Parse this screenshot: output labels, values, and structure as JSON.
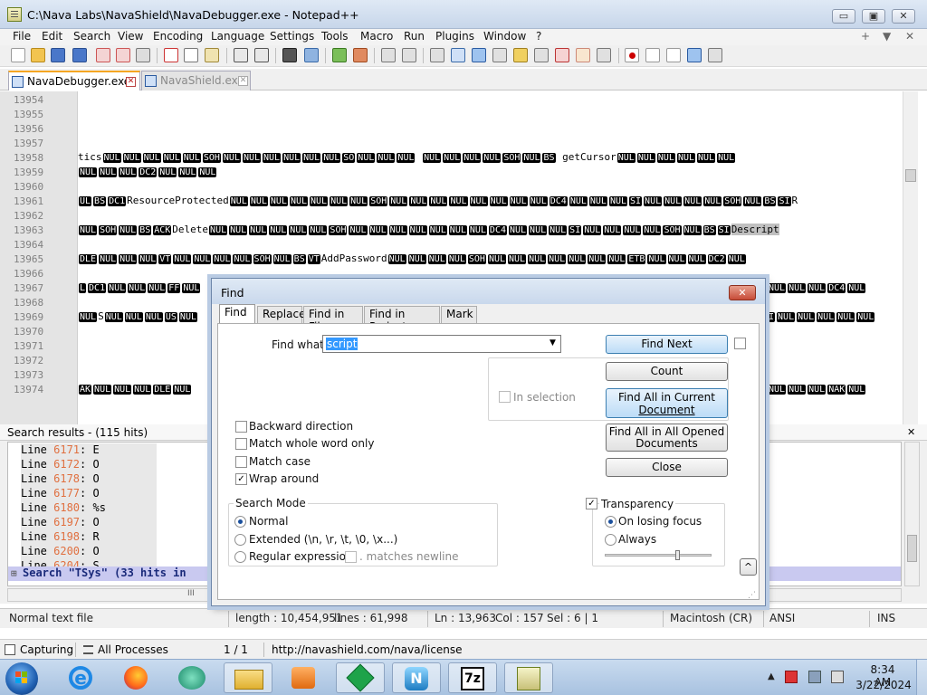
{
  "window": {
    "title": "C:\\Nava Labs\\NavaShield\\NavaDebugger.exe - Notepad++",
    "minimize": "▭",
    "restore": "▣",
    "close": "✕"
  },
  "menu": {
    "items": [
      "File",
      "Edit",
      "Search",
      "View",
      "Encoding",
      "Language",
      "Settings",
      "Tools",
      "Macro",
      "Run",
      "Plugins",
      "Window",
      "?"
    ],
    "right_controls": [
      "+",
      "▼",
      "✕"
    ]
  },
  "tabs": [
    {
      "label": "NavaDebugger.exe",
      "active": true
    },
    {
      "label": "NavaShield.exe",
      "active": false
    }
  ],
  "editor": {
    "lines": [
      {
        "n": "13954",
        "text": ""
      },
      {
        "n": "13955",
        "text": ""
      },
      {
        "n": "13956",
        "text": ""
      },
      {
        "n": "13957",
        "text": ""
      },
      {
        "n": "13958",
        "text": "tics[NUL][NUL][NUL][NUL][NUL][SOH][NUL][NUL][NUL][NUL][NUL][NUL][SO][NUL][NUL][NUL]    [NUL][NUL][NUL][NUL][SOH][NUL][BS]  getCursor[NUL][NUL][NUL][NUL][NUL][NUL]"
      },
      {
        "n": "13959",
        "text": "[NUL][NUL][NUL][DC2][NUL][NUL][NUL]"
      },
      {
        "n": "13960",
        "text": ""
      },
      {
        "n": "13961",
        "text": "[UL][BS][DC1]ResourceProtected[NUL][NUL][NUL][NUL][NUL][NUL][NUL][SOH][NUL][NUL][NUL][NUL][NUL][NUL][NUL][NUL][DC4][NUL][NUL][NUL][SI][NUL][NUL][NUL][NUL][SOH][NUL][BS][SI]R"
      },
      {
        "n": "13962",
        "text": ""
      },
      {
        "n": "13963",
        "text": "[NUL][SOH][NUL][BS][ACK]Delete[NUL][NUL][NUL][NUL][NUL][NUL][SOH][NUL][NUL][NUL][NUL][NUL][NUL][NUL][DC4][NUL][NUL][NUL][SI][NUL][NUL][NUL][NUL][SOH][NUL][BS][SI]{Descript}"
      },
      {
        "n": "13964",
        "text": ""
      },
      {
        "n": "13965",
        "text": "[DLE][NUL][NUL][NUL][VT][NUL][NUL][NUL][NUL][SOH][NUL][BS][VT]AddPassword[NUL][NUL][NUL][NUL][SOH][NUL][NUL][NUL][NUL][NUL][NUL][NUL][ETB][NUL][NUL][NUL][DC2][NUL]"
      },
      {
        "n": "13966",
        "text": ""
      },
      {
        "n": "13967",
        "text": "[L][DC1][NUL][NUL][NUL][FF][NUL]"
      },
      {
        "n": "13968",
        "text": ""
      },
      {
        "n": "13969",
        "text": "[NUL]S[NUL][NUL][NUL][US][NUL]"
      },
      {
        "n": "13970",
        "text": ""
      },
      {
        "n": "13971",
        "text": ""
      },
      {
        "n": "13972",
        "text": ""
      },
      {
        "n": "13973",
        "text": ""
      },
      {
        "n": "13974",
        "text": "[AK][NUL][NUL][NUL][DLE][NUL]"
      }
    ],
    "right_fragments": [
      {
        "line": "13967",
        "text": "[NUL][NUL][NUL][DC4][NUL]"
      },
      {
        "line": "13969",
        "text": "[I][NUL][NUL][NUL][NUL][NUL]"
      },
      {
        "line": "13974",
        "text": "[NUL][NUL][NUL][NAK][NUL]"
      }
    ]
  },
  "results": {
    "title": "Search results - (115 hits)",
    "close": "✕",
    "lines": [
      {
        "label": "Line",
        "num": "6171",
        "text": "E"
      },
      {
        "label": "Line",
        "num": "6172",
        "text": "O"
      },
      {
        "label": "Line",
        "num": "6178",
        "text": "O"
      },
      {
        "label": "Line",
        "num": "6177",
        "text": "O"
      },
      {
        "label": "Line",
        "num": "6180",
        "text": "%s"
      },
      {
        "label": "Line",
        "num": "6197",
        "text": "O"
      },
      {
        "label": "Line",
        "num": "6198",
        "text": "R"
      },
      {
        "label": "Line",
        "num": "6200",
        "text": "O"
      },
      {
        "label": "Line",
        "num": "6204",
        "text": "S"
      }
    ],
    "summary": "Search \"TSys\" (33 hits in",
    "scroll_marker": "III"
  },
  "find_dialog": {
    "title": "Find",
    "close": "✕",
    "tabs": [
      "Find",
      "Replace",
      "Find in Files",
      "Find in Projects",
      "Mark"
    ],
    "find_what_label": "Find what:",
    "find_what_value": "script",
    "in_selection": "In selection",
    "buttons": {
      "find_next": "Find Next",
      "count": "Count",
      "find_all_current_1": "Find All in Current",
      "find_all_current_2": "Document",
      "find_all_opened_1": "Find All in All Opened",
      "find_all_opened_2": "Documents",
      "close": "Close",
      "collapse": "^"
    },
    "options": [
      {
        "label": "Backward direction",
        "checked": false
      },
      {
        "label": "Match whole word only",
        "checked": false
      },
      {
        "label": "Match case",
        "checked": false
      },
      {
        "label": "Wrap around",
        "checked": true
      }
    ],
    "search_mode": {
      "title": "Search Mode",
      "normal": "Normal",
      "extended": "Extended (\\n, \\r, \\t, \\0, \\x...)",
      "regex": "Regular expression",
      "matches_newline": ". matches newline",
      "selected": "Normal"
    },
    "transparency": {
      "label": "Transparency",
      "checked": true,
      "on_losing_focus": "On losing focus",
      "always": "Always",
      "selected": "On losing focus",
      "slider_level": 0.7
    }
  },
  "status": {
    "lang": "Normal text file",
    "length": "length : 10,454,951",
    "lines": "lines : 61,998",
    "ln": "Ln : 13,963",
    "col": "Col : 157",
    "sel": "Sel : 6 | 1",
    "eol": "Macintosh (CR)",
    "encoding": "ANSI",
    "mode": "INS"
  },
  "capture_bar": {
    "capturing": "Capturing",
    "processes": "All Processes",
    "pages": "1 / 1",
    "url": "http://navashield.com/nava/license"
  },
  "taskbar": {
    "time": "8:34 AM",
    "date": "3/22/2024"
  },
  "colors": {
    "accent": "#3c7fb1",
    "line_number": "#808080",
    "result_number": "#e07040"
  }
}
